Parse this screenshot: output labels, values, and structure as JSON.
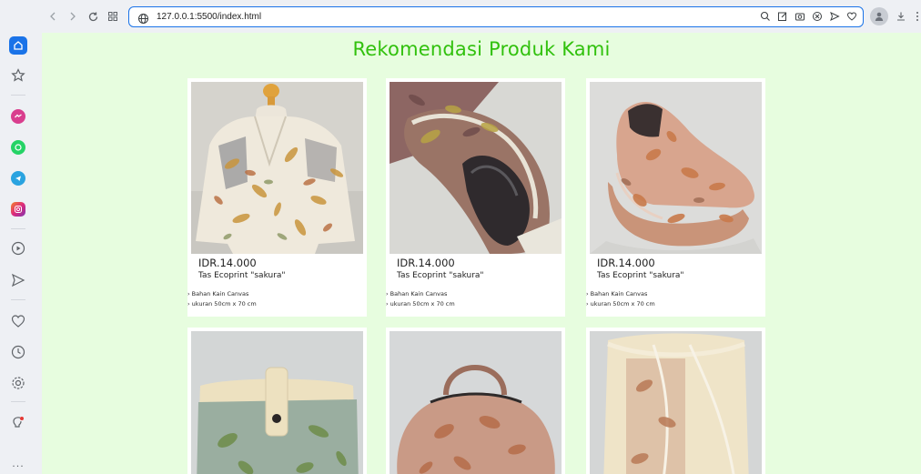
{
  "browser": {
    "url": "127.0.0.1:5500/index.html"
  },
  "page": {
    "title": "Rekomendasi Produk Kami",
    "products": [
      {
        "price": "IDR.14.000",
        "name": "Tas Ecoprint \"sakura\"",
        "features": [
          "› Bahan Kain Canvas",
          "› ukuran 50cm x 70 cm"
        ]
      },
      {
        "price": "IDR.14.000",
        "name": "Tas Ecoprint \"sakura\"",
        "features": [
          "› Bahan Kain Canvas",
          "› ukuran 50cm x 70 cm"
        ]
      },
      {
        "price": "IDR.14.000",
        "name": "Tas Ecoprint \"sakura\"",
        "features": [
          "› Bahan Kain Canvas",
          "› ukuran 50cm x 70 cm"
        ]
      }
    ]
  },
  "colors": {
    "accent": "#1a73e8",
    "page_background": "#e7fddf",
    "title": "#31c10d"
  },
  "sidebar": {
    "more_label": "..."
  }
}
